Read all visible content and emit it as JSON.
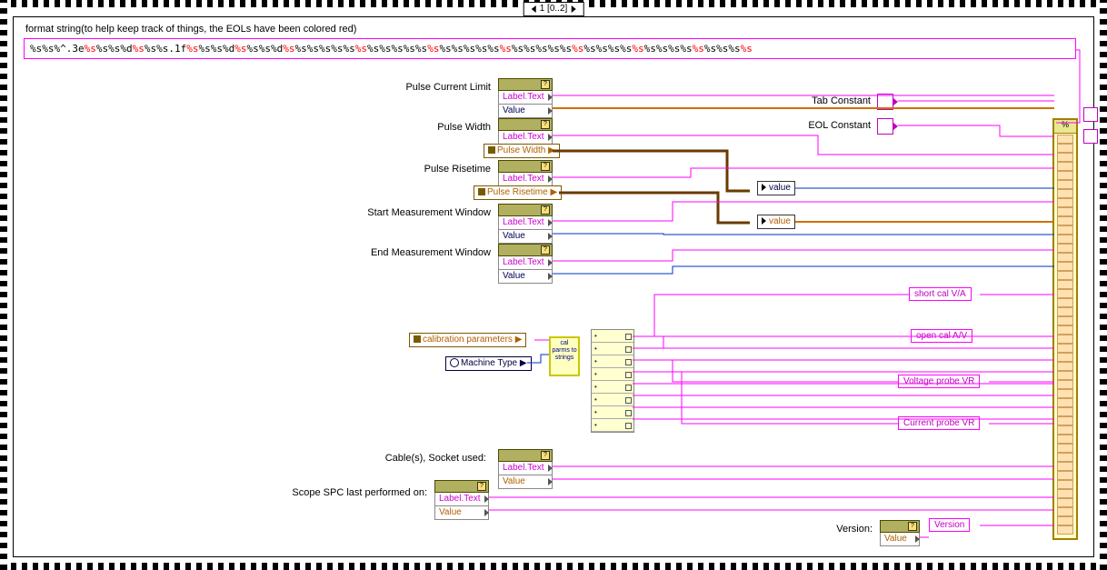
{
  "case_selector": "1 [0..2]",
  "format_string": {
    "caption": "format string(to help keep track of things, the EOLs have been colored red)",
    "segments": [
      "%s%s%^.3e",
      "%s",
      "%s%s%d",
      "%s",
      "%s%s.1f",
      "%s",
      "%s%s%d",
      "%s",
      "%s%s%d",
      "%s",
      "%s%s%s%s%s",
      "%s",
      "%s%s%s%s%s",
      "%s",
      "%s%s%s%s%s",
      "%s",
      "%s%s%s%s%s",
      "%s",
      "%s%s%s%s",
      "%s",
      "%s%s%s%s",
      "%s",
      "%s%s%s",
      "%s"
    ]
  },
  "nodes": {
    "pulse_current_limit": {
      "caption": "Pulse Current Limit",
      "rows": [
        "Label.Text",
        "Value"
      ]
    },
    "pulse_width": {
      "caption": "Pulse Width",
      "rows": [
        "Label.Text"
      ]
    },
    "pulse_width_local": "Pulse Width",
    "pulse_risetime": {
      "caption": "Pulse Risetime",
      "rows": [
        "Label.Text"
      ]
    },
    "pulse_risetime_local": "Pulse Risetime",
    "start_meas": {
      "caption": "Start Measurement Window",
      "rows": [
        "Label.Text",
        "Value"
      ]
    },
    "end_meas": {
      "caption": "End Measurement Window",
      "rows": [
        "Label.Text",
        "Value"
      ]
    },
    "cables": {
      "caption": "Cable(s), Socket used:",
      "rows": [
        "Label.Text",
        "Value"
      ]
    },
    "scope_spc": {
      "caption": "Scope SPC last performed on:",
      "rows": [
        "Label.Text",
        "Value"
      ]
    },
    "cal_params_local": "calibration parameters",
    "machine_type_local": "Machine Type",
    "subvi": "cal parms to strings",
    "value_blue": "value",
    "value_orange": "value"
  },
  "constants": {
    "tab": "Tab Constant",
    "eol": "EOL Constant"
  },
  "results": {
    "short_cal": "short cal V/A",
    "open_cal": "open cal A/V",
    "voltage_vr": "Voltage probe VR",
    "current_vr": "Current probe VR",
    "version_label": "Version:",
    "version": "Version"
  },
  "fmtnode_header": "%",
  "unbundle_count": 8,
  "chart_data": null
}
